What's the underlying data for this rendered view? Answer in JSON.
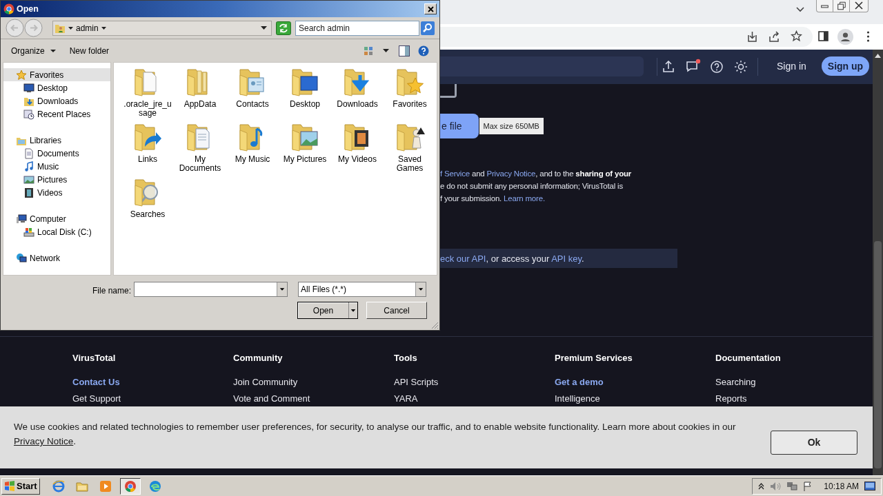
{
  "browser": {
    "header": {
      "buttons": [
        {
          "label": "Sign in",
          "kind": "plain"
        },
        {
          "label": "Sign up",
          "kind": "primary"
        }
      ]
    },
    "upload": {
      "button": "e file",
      "tooltip": "Max size 650MB"
    },
    "terms_lines": [
      [
        {
          "text": "f Service",
          "kind": "link"
        },
        {
          "text": " and ",
          "kind": "text"
        },
        {
          "text": "Privacy Notice",
          "kind": "link"
        },
        {
          "text": ", and to the ",
          "kind": "text"
        },
        {
          "text": "sharing of your",
          "kind": "bold"
        }
      ],
      [
        {
          "text": "e do not submit any personal information; VirusTotal is",
          "kind": "text"
        }
      ],
      [
        {
          "text": "f your submission. ",
          "kind": "text"
        },
        {
          "text": "Learn more.",
          "kind": "link"
        }
      ]
    ],
    "api_line": [
      {
        "text": "eck our API",
        "kind": "link"
      },
      {
        "text": ", or access your ",
        "kind": "text"
      },
      {
        "text": "API key",
        "kind": "link"
      },
      {
        "text": ".",
        "kind": "text"
      }
    ],
    "footer": {
      "columns": [
        {
          "heading": "VirusTotal",
          "links": [
            {
              "text": "Contact Us",
              "highlighted": true
            },
            {
              "text": "Get Support",
              "highlighted": false
            }
          ]
        },
        {
          "heading": "Community",
          "links": [
            {
              "text": "Join Community",
              "highlighted": false
            },
            {
              "text": "Vote and Comment",
              "highlighted": false
            }
          ]
        },
        {
          "heading": "Tools",
          "links": [
            {
              "text": "API Scripts",
              "highlighted": false
            },
            {
              "text": "YARA",
              "highlighted": false
            }
          ]
        },
        {
          "heading": "Premium Services",
          "links": [
            {
              "text": "Get a demo",
              "highlighted": true
            },
            {
              "text": "Intelligence",
              "highlighted": false
            }
          ]
        },
        {
          "heading": "Documentation",
          "links": [
            {
              "text": "Searching",
              "highlighted": false
            },
            {
              "text": "Reports",
              "highlighted": false
            }
          ]
        }
      ]
    },
    "cookie_banner": {
      "text": "We use cookies and related technologies to remember user preferences, for security, to analyse our traffic, and to enable website functionality. Learn more about cookies in our ",
      "link": "Privacy Notice",
      "after": ".",
      "button": "Ok"
    }
  },
  "dialog": {
    "title": "Open",
    "location": "admin",
    "search": {
      "placeholder": "Search admin"
    },
    "toolbar": [
      "Organize",
      "New folder"
    ],
    "nav": [
      {
        "label": "Favorites",
        "kind": "favorites",
        "selected": true,
        "children": [
          {
            "label": "Desktop",
            "kind": "desktop",
            "selected": false
          },
          {
            "label": "Downloads",
            "kind": "downloads",
            "selected": false
          },
          {
            "label": "Recent Places",
            "kind": "recent",
            "selected": false
          }
        ]
      },
      {
        "label": "Libraries",
        "kind": "libraries",
        "selected": false,
        "children": [
          {
            "label": "Documents",
            "kind": "documents",
            "selected": false
          },
          {
            "label": "Music",
            "kind": "music",
            "selected": false
          },
          {
            "label": "Pictures",
            "kind": "pictures",
            "selected": false
          },
          {
            "label": "Videos",
            "kind": "videos",
            "selected": false
          }
        ]
      },
      {
        "label": "Computer",
        "kind": "computer",
        "selected": false,
        "children": [
          {
            "label": "Local Disk (C:)",
            "kind": "disk",
            "selected": false
          }
        ]
      },
      {
        "label": "Network",
        "kind": "network",
        "selected": false
      }
    ],
    "items": [
      {
        "label": ".oracle_jre_usage",
        "kind": "file"
      },
      {
        "label": "AppData",
        "kind": "plain"
      },
      {
        "label": "Contacts",
        "kind": "contacts"
      },
      {
        "label": "Desktop",
        "kind": "desktop"
      },
      {
        "label": "Downloads",
        "kind": "downloads"
      },
      {
        "label": "Favorites",
        "kind": "favorites"
      },
      {
        "label": "Links",
        "kind": "links"
      },
      {
        "label": "My Documents",
        "kind": "documents"
      },
      {
        "label": "My Music",
        "kind": "music"
      },
      {
        "label": "My Pictures",
        "kind": "pictures"
      },
      {
        "label": "My Videos",
        "kind": "videos"
      },
      {
        "label": "Saved Games",
        "kind": "games"
      },
      {
        "label": "Searches",
        "kind": "searches"
      }
    ],
    "file_name": {
      "label": "File name:"
    },
    "file_type": "All Files (*.*)",
    "buttons": [
      {
        "label": "Open",
        "kind": "split"
      },
      {
        "label": "Cancel",
        "kind": "plain"
      }
    ]
  },
  "taskbar": {
    "start": "Start",
    "apps": [
      {
        "kind": "ie",
        "selected": false
      },
      {
        "kind": "explorer",
        "selected": false
      },
      {
        "kind": "media",
        "selected": false
      },
      {
        "kind": "chrome",
        "selected": true
      },
      {
        "kind": "edge",
        "selected": false
      }
    ],
    "clock": "10:18 AM"
  }
}
